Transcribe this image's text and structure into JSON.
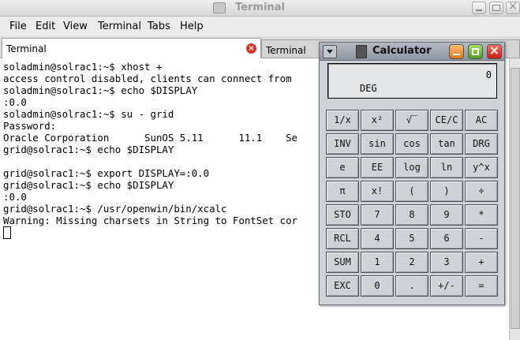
{
  "window": {
    "title": "Terminal"
  },
  "menubar": [
    "File",
    "Edit",
    "View",
    "Terminal",
    "Tabs",
    "Help"
  ],
  "tabs": [
    {
      "label": "Terminal",
      "active": true
    },
    {
      "label": "Terminal",
      "active": false
    }
  ],
  "terminal": {
    "lines": [
      "soladmin@solrac1:~$ xhost +",
      "access control disabled, clients can connect from",
      "soladmin@solrac1:~$ echo $DISPLAY",
      ":0.0",
      "soladmin@solrac1:~$ su - grid",
      "Password:",
      "Oracle Corporation      SunOS 5.11      11.1    Se",
      "grid@solrac1:~$ echo $DISPLAY",
      "",
      "grid@solrac1:~$ export DISPLAY=:0.0",
      "grid@solrac1:~$ echo $DISPLAY",
      ":0.0",
      "grid@solrac1:~$ /usr/openwin/bin/xcalc",
      "Warning: Missing charsets in String to FontSet cor"
    ]
  },
  "calculator": {
    "title": "Calculator",
    "display_value": "0",
    "angle_mode": "DEG",
    "keys": [
      [
        "1/x",
        "x²",
        "√‾",
        "CE/C",
        "AC"
      ],
      [
        "INV",
        "sin",
        "cos",
        "tan",
        "DRG"
      ],
      [
        "e",
        "EE",
        "log",
        "ln",
        "y^x"
      ],
      [
        "π",
        "x!",
        "(",
        ")",
        "÷"
      ],
      [
        "STO",
        "7",
        "8",
        "9",
        "*"
      ],
      [
        "RCL",
        "4",
        "5",
        "6",
        "-"
      ],
      [
        "SUM",
        "1",
        "2",
        "3",
        "+"
      ],
      [
        "EXC",
        "0",
        ".",
        "+/-",
        "="
      ]
    ]
  },
  "icons": {
    "tab_close": "close-icon",
    "calc_menu": "window-menu-icon",
    "calc_app": "calculator-icon"
  }
}
